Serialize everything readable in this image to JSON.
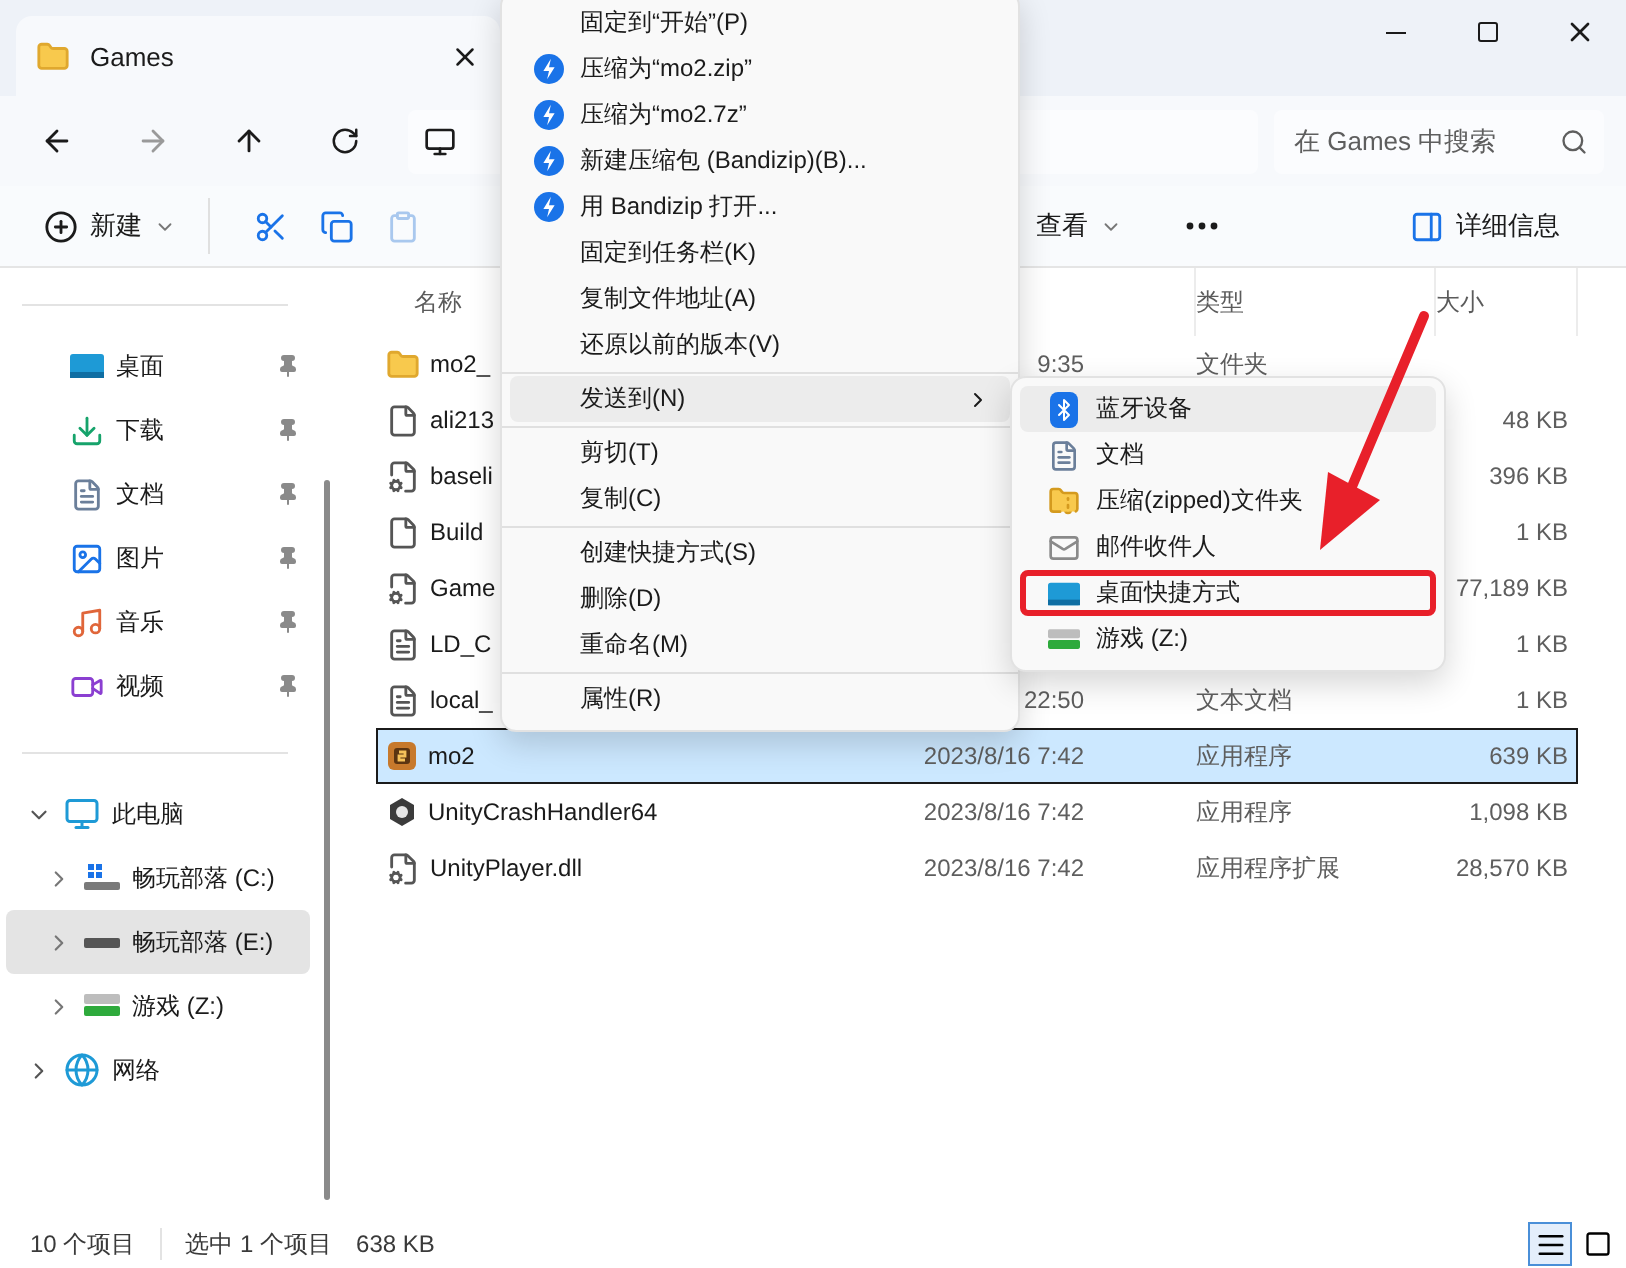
{
  "window": {
    "tab_title": "Games",
    "search": {
      "placeholder": "在 Games 中搜索"
    }
  },
  "toolbar": [
    {
      "kind": "new",
      "label": "新建",
      "disabled": false
    },
    {
      "kind": "cut",
      "disabled": false
    },
    {
      "kind": "copy",
      "disabled": false
    },
    {
      "kind": "paste",
      "disabled": true
    },
    {
      "kind": "view",
      "label": "查看",
      "disabled": false
    },
    {
      "kind": "more",
      "disabled": false
    },
    {
      "kind": "details",
      "label": "详细信息",
      "disabled": false
    }
  ],
  "sidebar": {
    "quick_access": [
      {
        "kind": "desktop",
        "label": "桌面",
        "pinned": true
      },
      {
        "kind": "downloads",
        "label": "下载",
        "pinned": true
      },
      {
        "kind": "documents",
        "label": "文档",
        "pinned": true
      },
      {
        "kind": "pictures",
        "label": "图片",
        "pinned": true
      },
      {
        "kind": "music",
        "label": "音乐",
        "pinned": true
      },
      {
        "kind": "videos",
        "label": "视频",
        "pinned": true
      }
    ],
    "tree": [
      {
        "kind": "pc",
        "label": "此电脑",
        "expanded": true,
        "selected": false,
        "children": [
          {
            "kind": "system-drive",
            "label": "畅玩部落 (C:)",
            "expanded": false,
            "selected": false
          },
          {
            "kind": "drive",
            "label": "畅玩部落 (E:)",
            "expanded": false,
            "selected": true
          },
          {
            "kind": "green-drive",
            "label": "游戏 (Z:)",
            "expanded": false,
            "selected": false
          }
        ]
      },
      {
        "kind": "network",
        "label": "网络",
        "expanded": false,
        "selected": false
      }
    ]
  },
  "file_list": {
    "columns": [
      {
        "kind": "name",
        "label": "名称"
      },
      {
        "kind": "type",
        "label": "类型"
      },
      {
        "kind": "size",
        "label": "大小"
      }
    ],
    "rows": [
      {
        "kind": "folder",
        "name": "mo2_",
        "date": "9:35",
        "type": "文件夹",
        "selected": false
      },
      {
        "kind": "file",
        "name": "ali213",
        "size": "48 KB",
        "selected": false
      },
      {
        "kind": "settings-file",
        "name": "baseli",
        "size": "396 KB",
        "selected": false
      },
      {
        "kind": "file",
        "name": "Build",
        "size": "1 KB",
        "selected": false
      },
      {
        "kind": "settings-file",
        "name": "Game",
        "size": "77,189 KB",
        "selected": false
      },
      {
        "kind": "text-file",
        "name": "LD_C",
        "size": "1 KB",
        "selected": false
      },
      {
        "kind": "text-file",
        "name": "local_",
        "date": "22:50",
        "type": "文本文档",
        "size": "1 KB",
        "selected": false
      },
      {
        "kind": "game-app",
        "name": "mo2",
        "date": "2023/8/16 7:42",
        "type": "应用程序",
        "size": "639 KB",
        "selected": true
      },
      {
        "kind": "cube-app",
        "name": "UnityCrashHandler64",
        "date": "2023/8/16 7:42",
        "type": "应用程序",
        "size": "1,098 KB",
        "selected": false
      },
      {
        "kind": "settings-file",
        "name": "UnityPlayer.dll",
        "date": "2023/8/16 7:42",
        "type": "应用程序扩展",
        "size": "28,570 KB",
        "selected": false
      }
    ]
  },
  "context_menu": {
    "items": [
      {
        "kind": "item",
        "label": "固定到“开始”(P)",
        "highlighted": false
      },
      {
        "kind": "bandizip",
        "label": "压缩为“mo2.zip”",
        "highlighted": false
      },
      {
        "kind": "bandizip",
        "label": "压缩为“mo2.7z”",
        "highlighted": false
      },
      {
        "kind": "bandizip",
        "label": "新建压缩包 (Bandizip)(B)...",
        "highlighted": false
      },
      {
        "kind": "bandizip",
        "label": "用 Bandizip 打开...",
        "highlighted": false
      },
      {
        "kind": "item",
        "label": "固定到任务栏(K)",
        "highlighted": false
      },
      {
        "kind": "item",
        "label": "复制文件地址(A)",
        "highlighted": false
      },
      {
        "kind": "item",
        "label": "还原以前的版本(V)",
        "highlighted": false
      },
      {
        "kind": "separator"
      },
      {
        "kind": "submenu",
        "label": "发送到(N)",
        "highlighted": true
      },
      {
        "kind": "separator"
      },
      {
        "kind": "item",
        "label": "剪切(T)",
        "highlighted": false
      },
      {
        "kind": "item",
        "label": "复制(C)",
        "highlighted": false
      },
      {
        "kind": "separator"
      },
      {
        "kind": "item",
        "label": "创建快捷方式(S)",
        "highlighted": false
      },
      {
        "kind": "item",
        "label": "删除(D)",
        "highlighted": false
      },
      {
        "kind": "item",
        "label": "重命名(M)",
        "highlighted": false
      },
      {
        "kind": "separator"
      },
      {
        "kind": "item",
        "label": "属性(R)",
        "highlighted": false
      }
    ]
  },
  "send_to_menu": {
    "items": [
      {
        "kind": "bluetooth",
        "label": "蓝牙设备",
        "highlighted": true,
        "framed": false
      },
      {
        "kind": "documents",
        "label": "文档",
        "highlighted": false,
        "framed": false
      },
      {
        "kind": "zip-folder",
        "label": "压缩(zipped)文件夹",
        "highlighted": false,
        "framed": false
      },
      {
        "kind": "mail",
        "label": "邮件收件人",
        "highlighted": false,
        "framed": false
      },
      {
        "kind": "desktop",
        "label": "桌面快捷方式",
        "highlighted": false,
        "framed": true
      },
      {
        "kind": "green-drive",
        "label": "游戏 (Z:)",
        "highlighted": false,
        "framed": false
      }
    ]
  },
  "status_bar": {
    "item_count": "10 个项目",
    "selection": "选中 1 个项目",
    "selection_size": "638 KB",
    "views": [
      {
        "kind": "details",
        "selected": true
      },
      {
        "kind": "tiles",
        "selected": false
      }
    ]
  }
}
